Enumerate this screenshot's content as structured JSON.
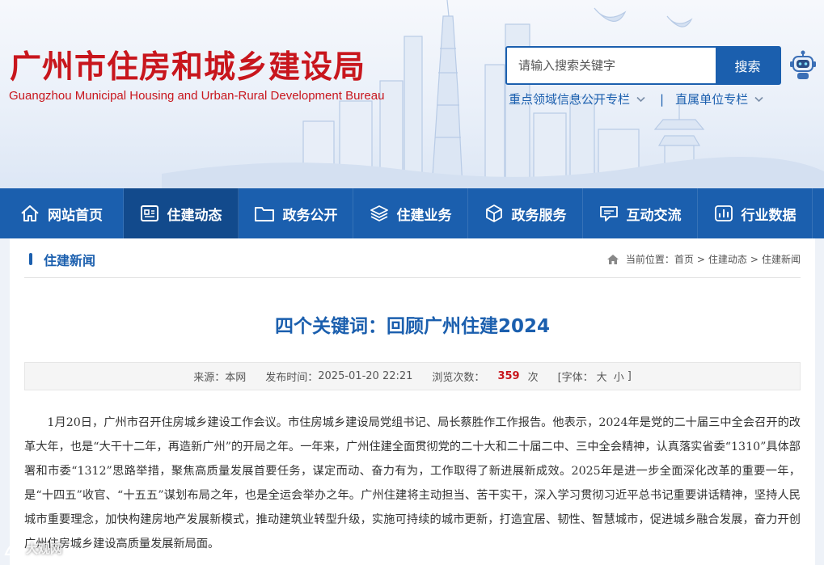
{
  "header": {
    "title": "广州市住房和城乡建设局",
    "subtitle": "Guangzhou Municipal Housing and Urban-Rural Development Bureau",
    "search_placeholder": "请输入搜索关键字",
    "search_button": "搜索",
    "quick_links": [
      "重点领域信息公开专栏",
      "直属单位专栏"
    ],
    "quick_sep": "|"
  },
  "nav": {
    "items": [
      {
        "label": "网站首页",
        "icon": "home-icon"
      },
      {
        "label": "住建动态",
        "icon": "news-icon"
      },
      {
        "label": "政务公开",
        "icon": "folder-icon"
      },
      {
        "label": "住建业务",
        "icon": "layers-icon"
      },
      {
        "label": "政务服务",
        "icon": "cube-icon"
      },
      {
        "label": "互动交流",
        "icon": "chat-icon"
      },
      {
        "label": "行业数据",
        "icon": "chart-icon"
      }
    ],
    "active_index": 1
  },
  "section": {
    "title": "住建新闻",
    "breadcrumb_prefix": "当前位置：",
    "breadcrumb": [
      "首页",
      "住建动态",
      "住建新闻"
    ],
    "breadcrumb_sep": ">"
  },
  "article": {
    "title": "四个关键词：回顾广州住建2024",
    "source_label": "来源：",
    "source": "本网",
    "date_label": "发布时间：",
    "date": "2025-01-20 22:21",
    "views_label": "浏览次数：",
    "views": "359",
    "views_unit": "次",
    "font_size_label": "[字体：",
    "font_large": "大",
    "font_small": "小",
    "font_size_close": "]",
    "body": "1月20日，广州市召开住房城乡建设工作会议。市住房城乡建设局党组书记、局长蔡胜作工作报告。他表示，2024年是党的二十届三中全会召开的改革大年，也是“大干十二年，再造新广州”的开局之年。一年来，广州住建全面贯彻党的二十大和二十届二中、三中全会精神，认真落实省委“1310”具体部署和市委“1312”思路举措，聚焦高质量发展首要任务，谋定而动、奋力有为，工作取得了新进展新成效。2025年是进一步全面深化改革的重要一年，是“十四五”收官、“十五五”谋划布局之年，也是全运会举办之年。广州住建将主动担当、苦干实干，深入学习贯彻习近平总书记重要讲话精神，坚持人民城市重要理念，加快构建房地产发展新模式，推动建筑业转型升级，实施可持续的城市更新，打造宜居、韧性、智慧城市，促进城乡融合发展，奋力开创广州住房城乡建设高质量发展新局面。"
  },
  "watermark": {
    "text": "大观网"
  },
  "colors": {
    "brand_red": "#c8161d",
    "brand_blue": "#1b5fae",
    "nav_active": "#124a8c"
  }
}
